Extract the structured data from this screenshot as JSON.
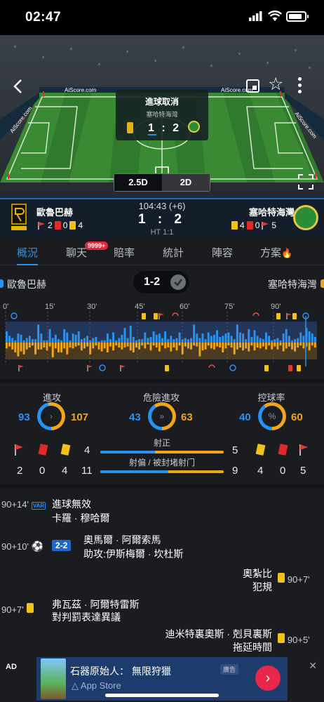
{
  "status": {
    "time": "02:47"
  },
  "stadium": {
    "ad_boards": [
      "AiScore.com",
      "AiScore.com",
      "AiScore.com",
      "AiScore.com"
    ],
    "goal_card": {
      "title": "進球取消",
      "team": "塞哈特海灣",
      "score_home": "1",
      "score_sep": ":",
      "score_away": "2"
    },
    "view_toggle": {
      "a": "2.5D",
      "b": "2D",
      "selected": "2.5D"
    }
  },
  "match": {
    "home": "歐魯巴赫",
    "away": "塞哈特海灣",
    "clock": "104:43 (+6)",
    "score": "1 : 2",
    "half_time": "HT 1:1",
    "home_stats": {
      "corners": "2",
      "red": "0",
      "yellow": "4"
    },
    "away_stats": {
      "yellow": "4",
      "red": "0",
      "corners": "5"
    }
  },
  "tabs": {
    "items": [
      "概況",
      "聊天",
      "賠率",
      "統計",
      "陣容",
      "方案"
    ],
    "active": "概況",
    "chat_badge": "9999+"
  },
  "summary": {
    "home": "歐魯巴赫",
    "away": "塞哈特海灣",
    "score": "1-2"
  },
  "timeline": {
    "ticks": [
      "0'",
      "15'",
      "30'",
      "45'",
      "60'",
      "75'",
      "90'"
    ],
    "home_pressure": [
      10,
      6,
      4,
      2,
      8,
      7,
      2,
      4,
      6,
      3,
      3,
      16,
      8,
      2,
      2,
      12,
      4,
      7,
      3,
      2,
      12,
      9,
      2,
      8,
      7,
      10,
      3,
      4,
      6,
      2,
      4,
      5,
      1,
      2,
      2,
      8,
      3,
      9,
      2,
      4,
      7,
      13,
      4,
      15,
      5,
      2,
      3,
      3,
      9,
      4,
      5,
      10,
      7,
      8,
      4,
      10,
      3,
      6,
      3,
      4,
      9,
      3,
      4,
      3,
      4,
      16,
      8,
      4,
      8,
      3,
      9,
      6,
      7,
      11,
      5,
      6,
      8,
      9,
      6,
      3,
      16,
      9,
      8,
      3,
      12,
      5,
      11,
      6,
      4,
      3,
      9,
      6,
      2,
      3,
      4,
      2,
      8,
      12,
      6,
      2,
      3,
      4,
      9,
      6,
      13,
      10,
      8,
      5
    ],
    "away_pressure": [
      6,
      4,
      7,
      10,
      14,
      9,
      12,
      7,
      5,
      3,
      12,
      7,
      7,
      5,
      8,
      4,
      15,
      6,
      10,
      10,
      6,
      12,
      5,
      6,
      4,
      3,
      8,
      6,
      4,
      12,
      6,
      3,
      7,
      9,
      6,
      10,
      4,
      8,
      3,
      5,
      7,
      5,
      4,
      8,
      10,
      5,
      7,
      3,
      6,
      2,
      8,
      3,
      5,
      9,
      3,
      6,
      5,
      9,
      5,
      8,
      3,
      12,
      4,
      6,
      7,
      3,
      4,
      14,
      8,
      7,
      3,
      6,
      7,
      4,
      5,
      10,
      6,
      3,
      5,
      12,
      7,
      5,
      8,
      6,
      9,
      3,
      8,
      5,
      6,
      4,
      7,
      3,
      7,
      4,
      7,
      3,
      9,
      6,
      4,
      7,
      9,
      5,
      3,
      6,
      4,
      8,
      3,
      5
    ]
  },
  "stats": {
    "groups": [
      {
        "label": "進攻",
        "home": "93",
        "away": "107",
        "home_frac": 0.465,
        "icon": "chevron-icon"
      },
      {
        "label": "危險進攻",
        "home": "43",
        "away": "63",
        "home_frac": 0.406,
        "icon": "fast-forward-icon"
      },
      {
        "label": "控球率",
        "home": "40",
        "away": "60",
        "home_frac": 0.4,
        "icon": "percent-icon"
      }
    ],
    "shots_on": {
      "label": "射正",
      "home": "4",
      "away": "5",
      "home_frac": 0.444
    },
    "shots_off": {
      "label": "射偏 / 被封堵射门",
      "home": "11",
      "away": "9",
      "home_frac": 0.55
    },
    "home_row": {
      "corners": "2",
      "red": "0",
      "yellow": "4"
    },
    "away_row": {
      "yellow": "4",
      "red": "0",
      "corners": "5"
    }
  },
  "events": [
    {
      "time": "90+14'",
      "title": "進球無效",
      "sub": "卡羅 · 穆哈爾",
      "side": "home",
      "icon": "var-icon",
      "var": "VAR"
    },
    {
      "time": "90+10'",
      "title": "奧馬爾 · 阿爾索馬",
      "sub": "助攻:伊斯梅爾 · 坎杜斯",
      "side": "home",
      "icon": "goal-icon",
      "score": "2-2"
    },
    {
      "time": "90+7'",
      "title": "奧紮比",
      "sub": "犯規",
      "side": "away",
      "icon": "yellow-card-icon"
    },
    {
      "time": "90+7'",
      "title": "弗瓦茲 · 阿爾特雷斯",
      "sub": "對判罰表達異議",
      "side": "home",
      "icon": "yellow-card-icon"
    },
    {
      "time": "90+5'",
      "title": "迪米特裏奧斯 · 剋貝裏斯",
      "sub": "拖延時間",
      "side": "away",
      "icon": "yellow-card-icon"
    }
  ],
  "ad": {
    "label": "AD",
    "title": "石器原始人： 無限狩獵",
    "store": "App Store",
    "tag": "廣告",
    "colors": {
      "cta": "#e8284a"
    }
  },
  "colors": {
    "home": "#2a92f0",
    "away": "#f2a516",
    "background": "#1b1c20"
  }
}
